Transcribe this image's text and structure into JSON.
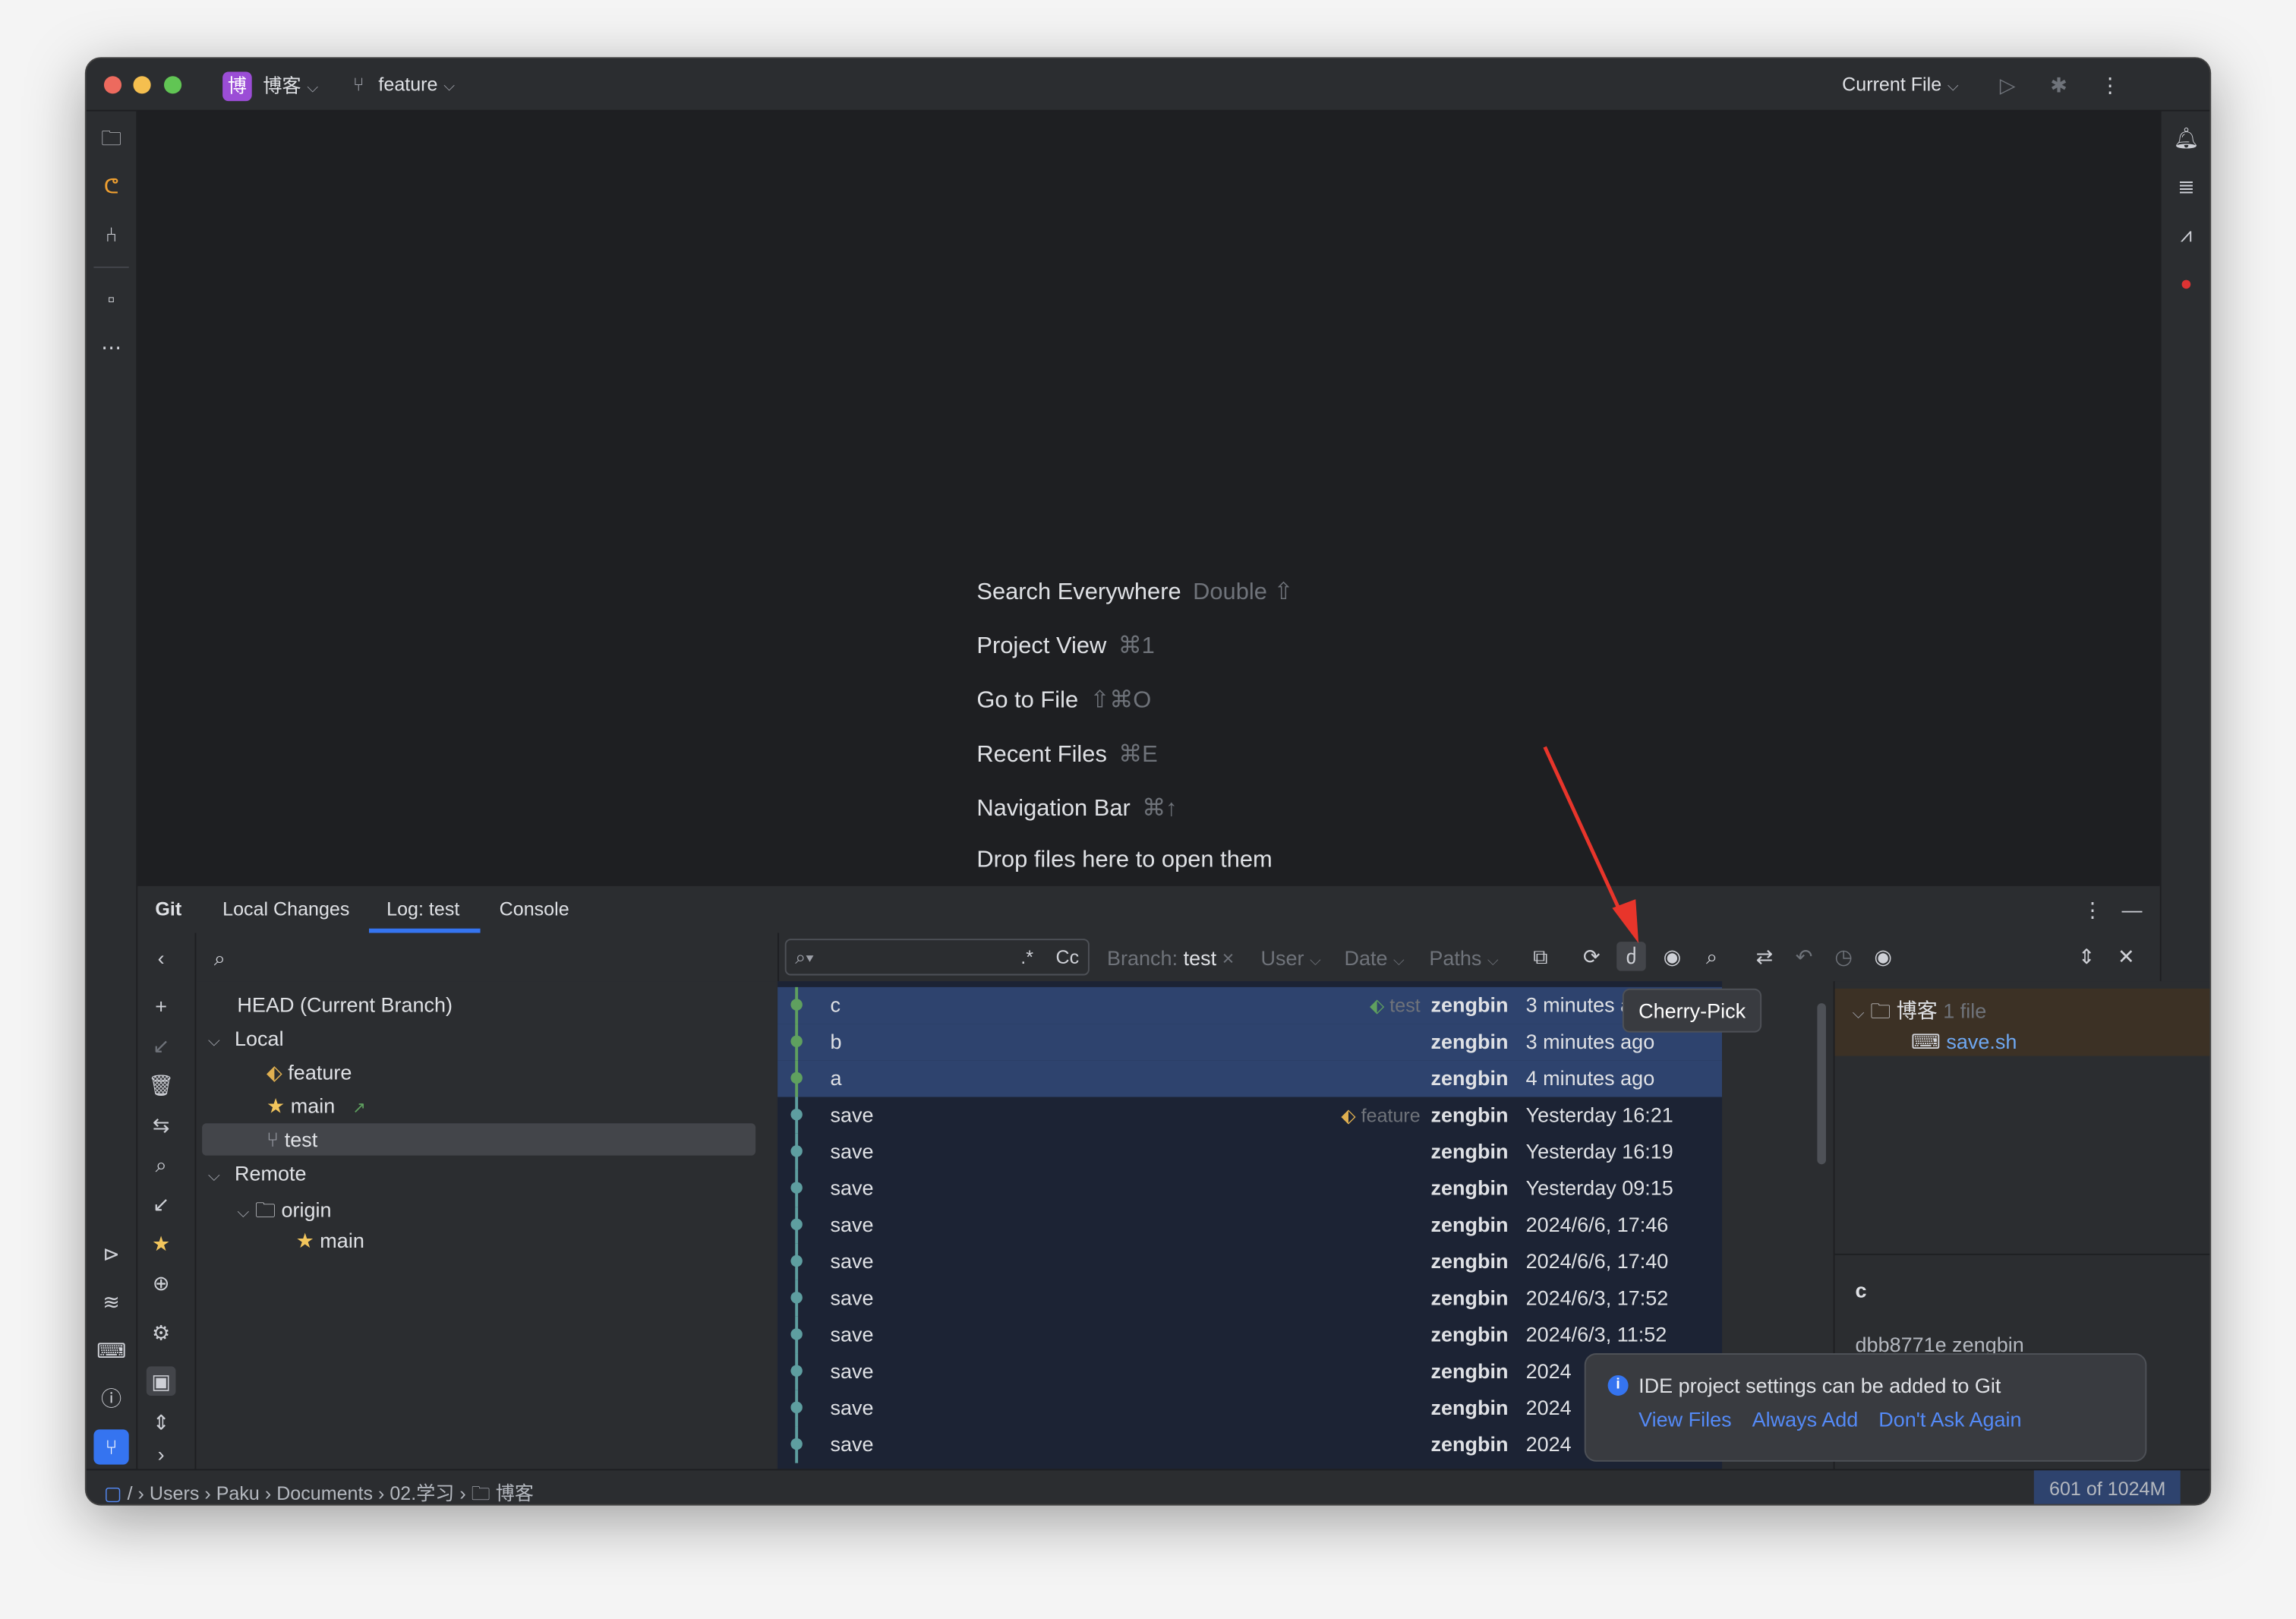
{
  "titlebar": {
    "project_badge": "博",
    "project": "博客",
    "branch": "feature",
    "run_config": "Current File"
  },
  "welcome": {
    "items": [
      {
        "label": "Search Everywhere",
        "shortcut": "Double ⇧"
      },
      {
        "label": "Project View",
        "shortcut": "⌘1"
      },
      {
        "label": "Go to File",
        "shortcut": "⇧⌘O"
      },
      {
        "label": "Recent Files",
        "shortcut": "⌘E"
      },
      {
        "label": "Navigation Bar",
        "shortcut": "⌘↑"
      },
      {
        "label": "Drop files here to open them",
        "shortcut": ""
      }
    ]
  },
  "git": {
    "title": "Git",
    "tabs": [
      "Local Changes",
      "Log: test",
      "Console"
    ],
    "active_tab": 1
  },
  "branches": {
    "head": "HEAD (Current Branch)",
    "local": "Local",
    "local_items": [
      "feature",
      "main",
      "test"
    ],
    "remote": "Remote",
    "origin": "origin",
    "remote_items": [
      "main"
    ]
  },
  "log_toolbar": {
    "search_placeholder": "",
    "regex": ".*",
    "case": "Cc",
    "branch_label": "Branch:",
    "branch_value": "test",
    "user": "User",
    "date": "Date",
    "paths": "Paths"
  },
  "tooltip": "Cherry-Pick",
  "commits": [
    {
      "subject": "c",
      "ref": "test",
      "author": "zengbin",
      "date": "3 minutes ago",
      "selected": true
    },
    {
      "subject": "b",
      "ref": "",
      "author": "zengbin",
      "date": "3 minutes ago",
      "selected": true
    },
    {
      "subject": "a",
      "ref": "",
      "author": "zengbin",
      "date": "4 minutes ago",
      "selected": true
    },
    {
      "subject": "save",
      "ref": "feature",
      "author": "zengbin",
      "date": "Yesterday 16:21",
      "selected": false
    },
    {
      "subject": "save",
      "ref": "",
      "author": "zengbin",
      "date": "Yesterday 16:19",
      "selected": false
    },
    {
      "subject": "save",
      "ref": "",
      "author": "zengbin",
      "date": "Yesterday 09:15",
      "selected": false
    },
    {
      "subject": "save",
      "ref": "",
      "author": "zengbin",
      "date": "2024/6/6, 17:46",
      "selected": false
    },
    {
      "subject": "save",
      "ref": "",
      "author": "zengbin",
      "date": "2024/6/6, 17:40",
      "selected": false
    },
    {
      "subject": "save",
      "ref": "",
      "author": "zengbin",
      "date": "2024/6/3, 17:52",
      "selected": false
    },
    {
      "subject": "save",
      "ref": "",
      "author": "zengbin",
      "date": "2024/6/3, 11:52",
      "selected": false
    },
    {
      "subject": "save",
      "ref": "",
      "author": "zengbin",
      "date": "2024",
      "selected": false
    },
    {
      "subject": "save",
      "ref": "",
      "author": "zengbin",
      "date": "2024",
      "selected": false
    },
    {
      "subject": "save",
      "ref": "",
      "author": "zengbin",
      "date": "2024",
      "selected": false
    }
  ],
  "details": {
    "folder": "博客",
    "count": "1 file",
    "file": "save.sh",
    "commit_subject": "c",
    "commit_meta": "dbb8771e zengbin"
  },
  "notification": {
    "message": "IDE project settings can be added to Git",
    "actions": [
      "View Files",
      "Always Add",
      "Don't Ask Again"
    ]
  },
  "statusbar": {
    "path": [
      "Users",
      "Paku",
      "Documents",
      "02.学习",
      "博客"
    ],
    "memory": "601 of 1024M"
  },
  "colors": {
    "accent": "#3574f0",
    "selection": "#2e436e",
    "graph": "#5fa05f",
    "graph_old": "#5e9ea0",
    "brand": "#9b4dd6"
  }
}
